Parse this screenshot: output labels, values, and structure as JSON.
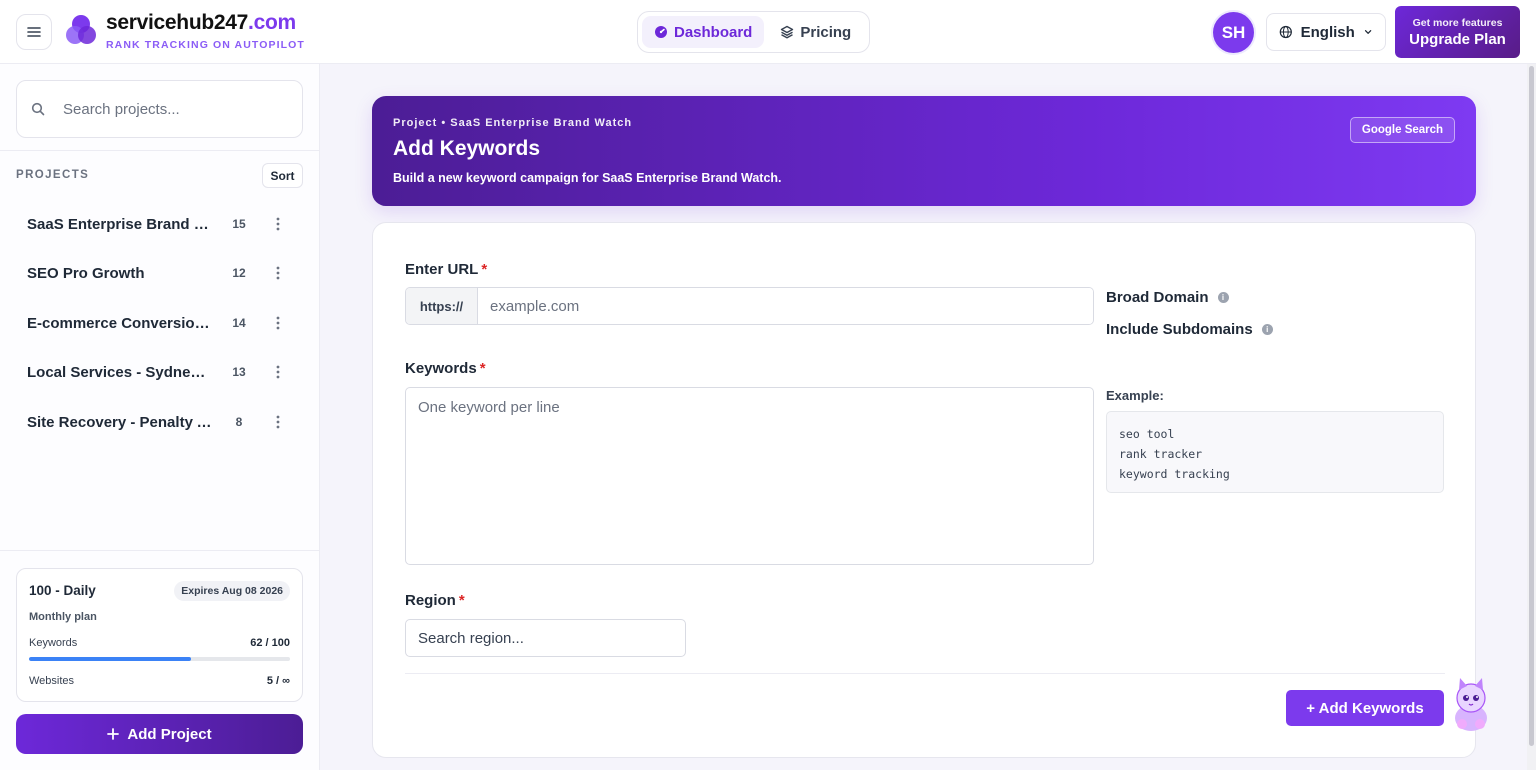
{
  "header": {
    "brand_name": "servicehub247",
    "brand_tld": ".com",
    "tagline": "RANK TRACKING ON AUTOPILOT",
    "nav": [
      {
        "label": "Dashboard",
        "active": true,
        "icon": "dashboard-gauge-icon"
      },
      {
        "label": "Pricing",
        "active": false,
        "icon": "layers-icon"
      }
    ],
    "avatar_initials": "SH",
    "language": "English",
    "upgrade_small": "Get more features",
    "upgrade_big": "Upgrade Plan"
  },
  "sidebar": {
    "search_placeholder": "Search projects...",
    "projects_label": "PROJECTS",
    "sort_label": "Sort",
    "projects": [
      {
        "name": "SaaS Enterprise Brand Watch",
        "count": "15"
      },
      {
        "name": "SEO Pro Growth",
        "count": "12"
      },
      {
        "name": "E-commerce Conversions",
        "count": "14"
      },
      {
        "name": "Local Services - Sydney Metro",
        "count": "13"
      },
      {
        "name": "Site Recovery - Penalty Audit",
        "count": "8"
      }
    ],
    "plan": {
      "title": "100 - Daily",
      "expires": "Expires Aug 08 2026",
      "subtitle": "Monthly plan",
      "keywords_label": "Keywords",
      "keywords_value": "62 / 100",
      "keywords_fraction": 0.62,
      "websites_label": "Websites",
      "websites_value": "5 / ∞"
    },
    "add_project_label": "Add Project"
  },
  "banner": {
    "breadcrumb": "Project • SaaS Enterprise Brand Watch",
    "title": "Add Keywords",
    "subtitle": "Build a new keyword campaign for SaaS Enterprise Brand Watch.",
    "google_button": "Google Search"
  },
  "form": {
    "url_label": "Enter URL",
    "url_prefix": "https://",
    "url_placeholder": "example.com",
    "broad_domain_label": "Broad Domain",
    "include_subdomains_label": "Include Subdomains",
    "keywords_label": "Keywords",
    "keywords_placeholder": "One keyword per line",
    "example_label": "Example:",
    "example_lines": [
      "seo tool",
      "rank tracker",
      "keyword tracking"
    ],
    "region_label": "Region",
    "region_placeholder": "Search region...",
    "submit_label": "+ Add Keywords",
    "required_mark": "*"
  },
  "colors": {
    "accent": "#7c3aed",
    "banner_start": "#4c1d95",
    "progress": "#3b82f6",
    "required": "#dc2626"
  }
}
